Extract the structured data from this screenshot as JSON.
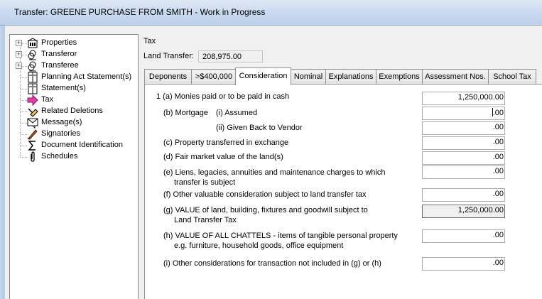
{
  "window": {
    "title": "Transfer: GREENE PURCHASE FROM SMITH - Work in Progress"
  },
  "tree": {
    "items": [
      {
        "label": "Properties",
        "icon": "building-icon",
        "expandable": true
      },
      {
        "label": "Transferor",
        "icon": "people-icon",
        "expandable": true
      },
      {
        "label": "Transferee",
        "icon": "people-icon",
        "expandable": true
      },
      {
        "label": "Planning Act Statement(s)",
        "icon": "book-icon",
        "expandable": false
      },
      {
        "label": "Statement(s)",
        "icon": "book-icon",
        "expandable": false
      },
      {
        "label": "Tax",
        "icon": "pink-arrow-icon",
        "expandable": false
      },
      {
        "label": "Related Deletions",
        "icon": "eraser-icon",
        "expandable": false
      },
      {
        "label": "Message(s)",
        "icon": "message-icon",
        "expandable": false
      },
      {
        "label": "Signatories",
        "icon": "quill-icon",
        "expandable": false
      },
      {
        "label": "Document Identification",
        "icon": "sigma-icon",
        "expandable": false
      },
      {
        "label": "Schedules",
        "icon": "paperclip-icon",
        "expandable": false
      }
    ]
  },
  "section_title": "Tax",
  "land_transfer": {
    "label": "Land Transfer:",
    "value": "208,975.00"
  },
  "tabs": [
    {
      "label": "Deponents"
    },
    {
      "label": ">$400,000"
    },
    {
      "label": "Consideration",
      "active": true
    },
    {
      "label": "Nominal"
    },
    {
      "label": "Explanations"
    },
    {
      "label": "Exemptions"
    },
    {
      "label": "Assessment Nos."
    },
    {
      "label": "School Tax"
    }
  ],
  "consideration": {
    "a": {
      "label": "1 (a) Monies paid or to be paid in cash",
      "value": "1,250,000.00"
    },
    "b_label": "(b) Mortgage",
    "b_i": {
      "label": "(i) Assumed",
      "value": ".00"
    },
    "b_ii": {
      "label": "(ii) Given Back to Vendor",
      "value": ".00"
    },
    "c": {
      "label": "(c) Property transferred in exchange",
      "value": ".00"
    },
    "d": {
      "label": "(d) Fair market value of the land(s)",
      "value": ".00"
    },
    "e": {
      "label1": "(e) Liens, legacies, annuities and maintenance charges to which",
      "label2": "transfer is subject",
      "value": ".00"
    },
    "f": {
      "label": "(f) Other valuable consideration subject to land transfer tax",
      "value": ".00"
    },
    "g": {
      "label1": "(g) VALUE of land, building, fixtures and goodwill subject to",
      "label2": "Land Transfer Tax",
      "value": "1,250,000.00"
    },
    "h": {
      "label1": "(h) VALUE OF ALL CHATTELS - items of tangible personal property",
      "label2": "e.g. furniture, household goods, office equipment",
      "value": ".00"
    },
    "i": {
      "label": "(i) Other considerations for transaction not included in (g) or (h)",
      "value": ".00"
    }
  }
}
